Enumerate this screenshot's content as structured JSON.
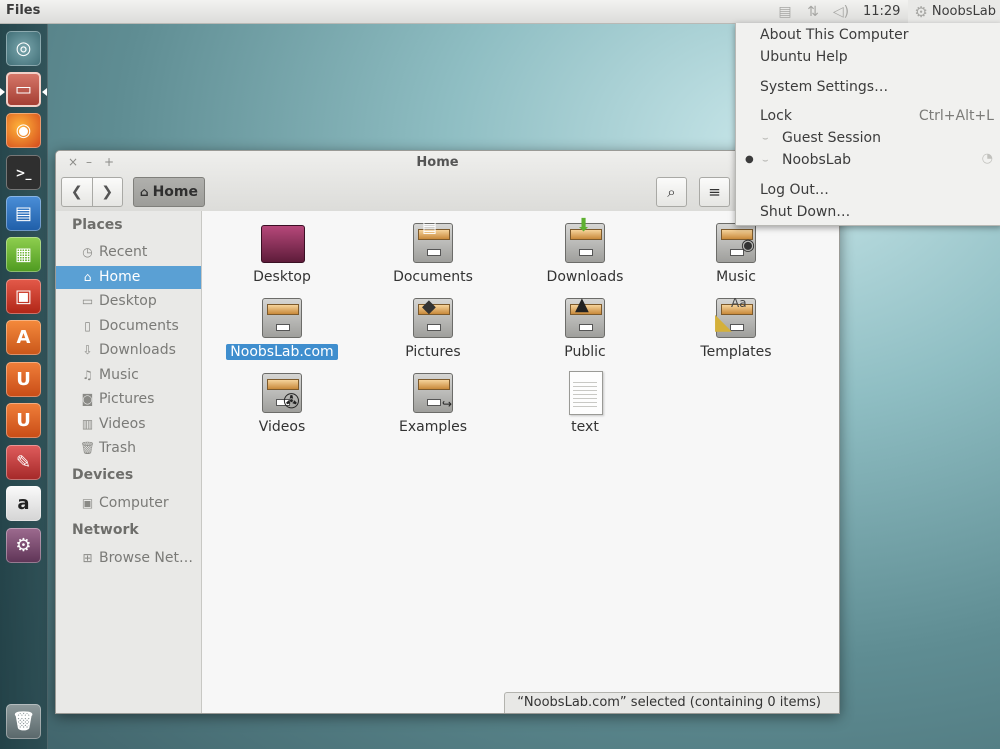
{
  "panel": {
    "app_title": "Files",
    "clock": "11:29",
    "user": "NoobsLab",
    "icons": [
      "clipboard-icon",
      "network-icon",
      "volume-icon",
      "gear-icon"
    ]
  },
  "session_menu": {
    "about": "About This Computer",
    "help": "Ubuntu Help",
    "settings": "System Settings…",
    "lock": "Lock",
    "lock_shortcut": "Ctrl+Alt+L",
    "guest": "Guest Session",
    "current_user": "NoobsLab",
    "logout": "Log Out…",
    "shutdown": "Shut Down…"
  },
  "launcher": {
    "items": [
      "dash-icon",
      "files-icon",
      "firefox-icon",
      "terminal-icon",
      "writer-icon",
      "calc-icon",
      "impress-icon",
      "software-center-icon",
      "ubuntu-one-icon",
      "ubuntu-one-music-icon",
      "settings-icon",
      "amazon-icon",
      "system-settings-icon",
      "trash-icon"
    ]
  },
  "window": {
    "title": "Home",
    "path_button": "Home",
    "controls": {
      "close": "×",
      "minimize": "–",
      "maximize": "+"
    }
  },
  "sidebar": {
    "places_heading": "Places",
    "places": [
      {
        "label": "Recent",
        "icon": "clock-icon"
      },
      {
        "label": "Home",
        "icon": "home-icon",
        "active": true
      },
      {
        "label": "Desktop",
        "icon": "folder-icon"
      },
      {
        "label": "Documents",
        "icon": "document-icon"
      },
      {
        "label": "Downloads",
        "icon": "download-icon"
      },
      {
        "label": "Music",
        "icon": "music-icon"
      },
      {
        "label": "Pictures",
        "icon": "camera-icon"
      },
      {
        "label": "Videos",
        "icon": "film-icon"
      },
      {
        "label": "Trash",
        "icon": "trash-icon"
      }
    ],
    "devices_heading": "Devices",
    "devices": [
      {
        "label": "Computer",
        "icon": "computer-icon"
      }
    ],
    "network_heading": "Network",
    "network": [
      {
        "label": "Browse Net…",
        "icon": "network-icon"
      }
    ]
  },
  "files": [
    {
      "label": "Desktop",
      "kind": "desktop"
    },
    {
      "label": "Documents",
      "kind": "documents"
    },
    {
      "label": "Downloads",
      "kind": "downloads"
    },
    {
      "label": "Music",
      "kind": "music"
    },
    {
      "label": "NoobsLab.com",
      "kind": "folder",
      "selected": true
    },
    {
      "label": "Pictures",
      "kind": "pictures"
    },
    {
      "label": "Public",
      "kind": "public"
    },
    {
      "label": "Templates",
      "kind": "templates"
    },
    {
      "label": "Videos",
      "kind": "videos"
    },
    {
      "label": "Examples",
      "kind": "examples"
    },
    {
      "label": "text",
      "kind": "text"
    }
  ],
  "status": "“NoobsLab.com” selected  (containing 0 items)",
  "colors": {
    "selection": "#3f8ece",
    "sidebar_active": "#5aa0d4"
  }
}
